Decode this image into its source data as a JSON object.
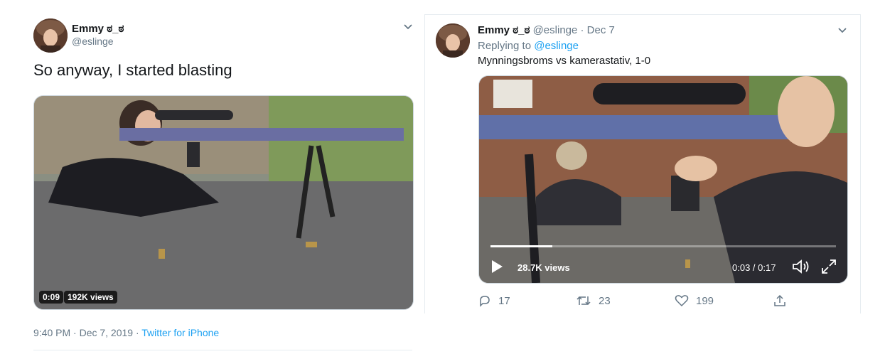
{
  "left_tweet": {
    "user_name": "Emmy ಠ_ಠ",
    "handle": "@eslinge",
    "text": "So anyway, I started blasting",
    "video_duration": "0:09",
    "views": "192K views",
    "timestamp": "9:40 PM · Dec 7, 2019 · ",
    "source": "Twitter for iPhone"
  },
  "right_tweet": {
    "user_name": "Emmy ಠ_ಠ",
    "handle": "@eslinge",
    "date": "· Dec 7",
    "replying_prefix": "Replying to ",
    "replying_to": "@eslinge",
    "text": "Mynningsbroms vs kamerastativ, 1-0",
    "views": "28.7K views",
    "time_display": "0:03 / 0:17",
    "progress": 0.18,
    "actions": {
      "replies": "17",
      "retweets": "23",
      "likes": "199"
    }
  },
  "colors": {
    "link": "#1da1f2",
    "secondary_text": "#657786",
    "border": "#e6ecf0"
  },
  "icons": [
    "chevron-down-icon",
    "play-icon",
    "volume-icon",
    "fullscreen-icon",
    "reply-icon",
    "retweet-icon",
    "like-icon",
    "share-icon"
  ]
}
